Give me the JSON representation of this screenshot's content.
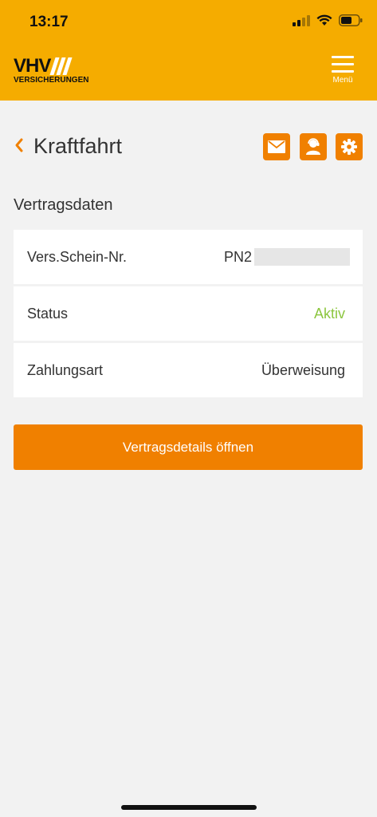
{
  "status_bar": {
    "time": "13:17"
  },
  "header": {
    "logo_main": "VHV",
    "logo_sub": "VERSICHERUNGEN",
    "menu_label": "Menü",
    "background_color": "#f5ac00"
  },
  "page": {
    "title": "Kraftfahrt",
    "icons": [
      "back-chevron-icon",
      "mail-icon",
      "contact-person-icon",
      "gear-icon"
    ]
  },
  "contract": {
    "section_title": "Vertragsdaten",
    "rows": [
      {
        "label": "Vers.Schein-Nr.",
        "value": "PN2"
      },
      {
        "label": "Status",
        "value": "Aktiv"
      },
      {
        "label": "Zahlungsart",
        "value": "Überweisung"
      }
    ]
  },
  "cta": {
    "label": "Vertragsdetails öffnen",
    "color": "#f08000"
  },
  "colors": {
    "accent": "#f08000",
    "status_active": "#8cc63f"
  }
}
